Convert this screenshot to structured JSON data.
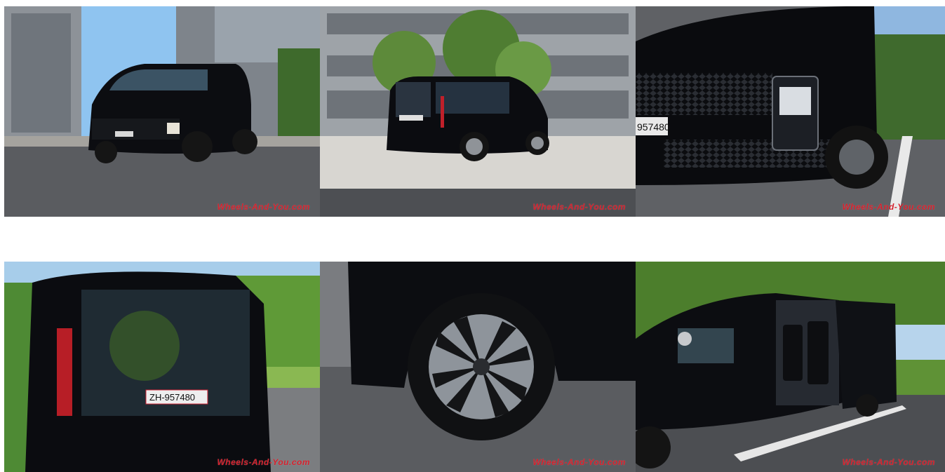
{
  "gallery": {
    "photos": [
      {
        "subject": "front three-quarter view of black van",
        "watermark": "Wheels-And-You.com"
      },
      {
        "subject": "rear three-quarter view of black van",
        "watermark": "Wheels-And-You.com"
      },
      {
        "subject": "front grille and headlight close-up",
        "watermark": "Wheels-And-You.com",
        "plate": "957480"
      },
      {
        "subject": "rear tailgate view",
        "watermark": "Wheels-And-You.com",
        "plate": "ZH-957480"
      },
      {
        "subject": "alloy wheel close-up",
        "watermark": "Wheels-And-You.com"
      },
      {
        "subject": "open sliding door with seats",
        "watermark": "Wheels-And-You.com"
      }
    ]
  },
  "colors": {
    "watermark": "#d4202c",
    "body": "#0d0e12",
    "sky": "#8ec3ef",
    "asphalt": "#5d5f63"
  }
}
